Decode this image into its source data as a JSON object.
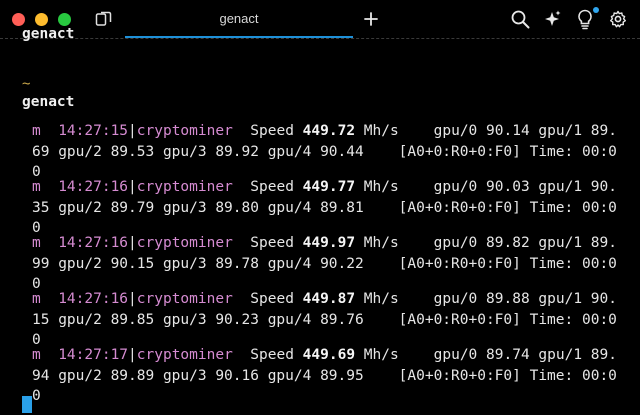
{
  "window": {
    "tab_title": "genact",
    "new_tab_label": "+"
  },
  "toolbar": {
    "icons": [
      "search-icon",
      "ai-sparkle-icon",
      "lightbulb-icon",
      "gear-icon"
    ],
    "notification_color": "#30a6ee"
  },
  "terminal": {
    "clipped_command": "genact",
    "prompt_symbol": "~",
    "command": "genact",
    "entries": [
      {
        "level": "m",
        "time": "14:27:15",
        "source": "cryptominer",
        "speed_label": "Speed",
        "speed": "449.72",
        "unit": "Mh/s",
        "gpus": "gpu/0 90.14 gpu/1 89.69 gpu/2 89.53 gpu/3 89.92 gpu/4 90.44",
        "tail": "[A0+0:R0+0:F0] Time: 00:00"
      },
      {
        "level": "m",
        "time": "14:27:16",
        "source": "cryptominer",
        "speed_label": "Speed",
        "speed": "449.77",
        "unit": "Mh/s",
        "gpus": "gpu/0 90.03 gpu/1 90.35 gpu/2 89.79 gpu/3 89.80 gpu/4 89.81",
        "tail": "[A0+0:R0+0:F0] Time: 00:00"
      },
      {
        "level": "m",
        "time": "14:27:16",
        "source": "cryptominer",
        "speed_label": "Speed",
        "speed": "449.97",
        "unit": "Mh/s",
        "gpus": "gpu/0 89.82 gpu/1 89.99 gpu/2 90.15 gpu/3 89.78 gpu/4 90.22",
        "tail": "[A0+0:R0+0:F0] Time: 00:00"
      },
      {
        "level": "m",
        "time": "14:27:16",
        "source": "cryptominer",
        "speed_label": "Speed",
        "speed": "449.87",
        "unit": "Mh/s",
        "gpus": "gpu/0 89.88 gpu/1 90.15 gpu/2 89.85 gpu/3 90.23 gpu/4 89.76",
        "tail": "[A0+0:R0+0:F0] Time: 00:00"
      },
      {
        "level": "m",
        "time": "14:27:17",
        "source": "cryptominer",
        "speed_label": "Speed",
        "speed": "449.69",
        "unit": "Mh/s",
        "gpus": "gpu/0 89.74 gpu/1 89.94 gpu/2 89.89 gpu/3 90.16 gpu/4 89.95",
        "tail": "[A0+0:R0+0:F0] Time: 00:00"
      }
    ]
  }
}
